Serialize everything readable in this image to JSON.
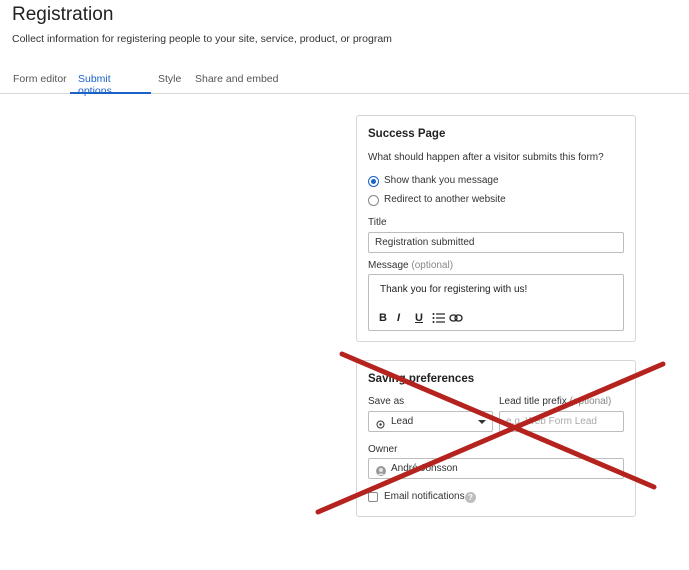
{
  "header": {
    "title": "Registration",
    "subtitle": "Collect information for registering people to your site, service, product, or program"
  },
  "tabs": [
    {
      "label": "Form editor"
    },
    {
      "label": "Submit options"
    },
    {
      "label": "Style"
    },
    {
      "label": "Share and embed"
    }
  ],
  "success_page": {
    "heading": "Success Page",
    "question": "What should happen after a visitor submits this form?",
    "options": [
      {
        "label": "Show thank you message",
        "selected": true
      },
      {
        "label": "Redirect to another website",
        "selected": false
      }
    ],
    "title_label": "Title",
    "title_value": "Registration submitted",
    "message_label": "Message",
    "message_optional": "(optional)",
    "message_value": "Thank you for registering with us!",
    "toolbar": {
      "bold": "B",
      "italic": "I",
      "underline": "U"
    }
  },
  "saving_preferences": {
    "heading": "Saving preferences",
    "save_as_label": "Save as",
    "save_as_value": "Lead",
    "lead_prefix_label": "Lead title prefix",
    "lead_prefix_optional": "(optional)",
    "lead_prefix_placeholder": "e.g. Web Form Lead",
    "owner_label": "Owner",
    "owner_value": "André Jonsson",
    "email_notifications_label": "Email notifications",
    "help": "?"
  },
  "colors": {
    "accent": "#1a62c6",
    "cross": "#b5231f"
  }
}
